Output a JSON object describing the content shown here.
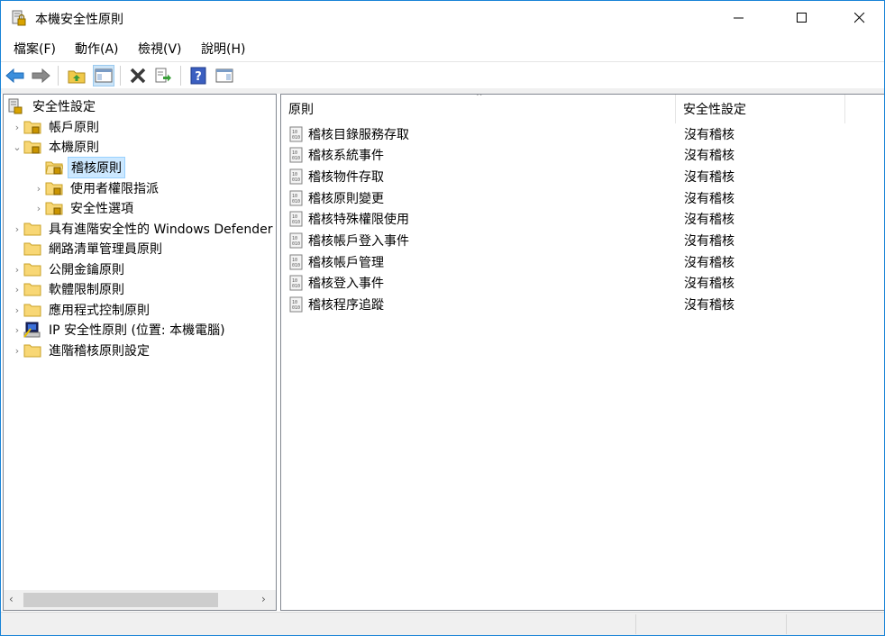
{
  "window": {
    "title": "本機安全性原則"
  },
  "menu": [
    {
      "label": "檔案(F)"
    },
    {
      "label": "動作(A)"
    },
    {
      "label": "檢視(V)"
    },
    {
      "label": "說明(H)"
    }
  ],
  "tree": {
    "root": "安全性設定",
    "items": [
      {
        "label": "帳戶原則"
      },
      {
        "label": "本機原則"
      },
      {
        "label": "稽核原則"
      },
      {
        "label": "使用者權限指派"
      },
      {
        "label": "安全性選項"
      },
      {
        "label": "具有進階安全性的 Windows Defender"
      },
      {
        "label": "網路清單管理員原則"
      },
      {
        "label": "公開金鑰原則"
      },
      {
        "label": "軟體限制原則"
      },
      {
        "label": "應用程式控制原則"
      },
      {
        "label": "IP 安全性原則 (位置: 本機電腦)"
      },
      {
        "label": "進階稽核原則設定"
      }
    ]
  },
  "list": {
    "columns": [
      "原則",
      "安全性設定"
    ],
    "rows": [
      {
        "name": "稽核目錄服務存取",
        "setting": "沒有稽核"
      },
      {
        "name": "稽核系統事件",
        "setting": "沒有稽核"
      },
      {
        "name": "稽核物件存取",
        "setting": "沒有稽核"
      },
      {
        "name": "稽核原則變更",
        "setting": "沒有稽核"
      },
      {
        "name": "稽核特殊權限使用",
        "setting": "沒有稽核"
      },
      {
        "name": "稽核帳戶登入事件",
        "setting": "沒有稽核"
      },
      {
        "name": "稽核帳戶管理",
        "setting": "沒有稽核"
      },
      {
        "name": "稽核登入事件",
        "setting": "沒有稽核"
      },
      {
        "name": "稽核程序追蹤",
        "setting": "沒有稽核"
      }
    ]
  },
  "colors": {
    "accent": "#1883d7",
    "selection": "#cce8ff",
    "folder": "#f8d775"
  }
}
